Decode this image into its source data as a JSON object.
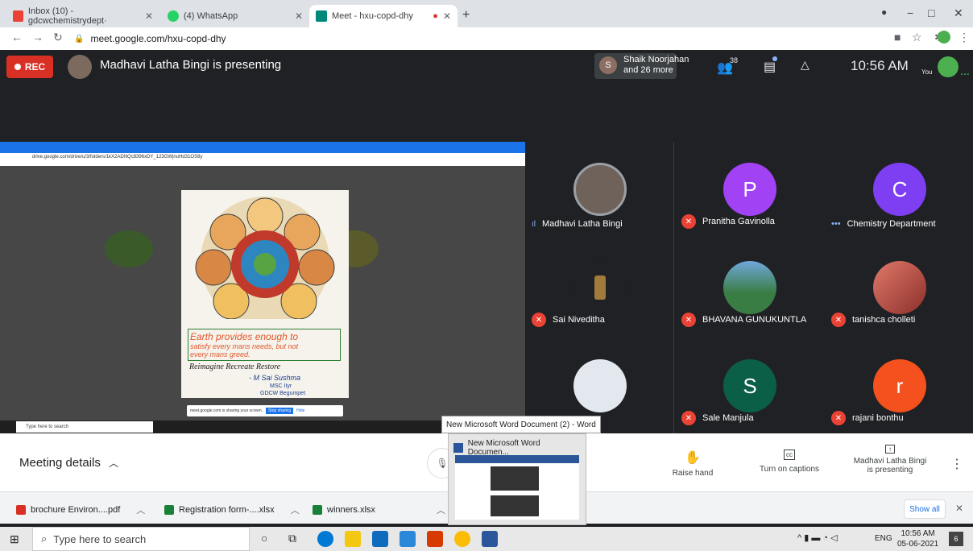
{
  "browser": {
    "tabs": [
      {
        "label": "Inbox (10) - gdcwchemistrydept·",
        "color": "#ea4335"
      },
      {
        "label": "(4) WhatsApp",
        "color": "#25d366"
      },
      {
        "label": "Meet - hxu-copd-dhy",
        "color": "#00897b"
      }
    ],
    "url": "meet.google.com/hxu-copd-dhy"
  },
  "meeting": {
    "rec_label": "REC",
    "presenting_title": "Madhavi Latha Bingi is presenting",
    "notify_name": "Shaik Noorjahan",
    "notify_more": "and 26 more",
    "notify_initial": "S",
    "people_count": "38",
    "time": "10:56 AM",
    "you_label": "You"
  },
  "share": {
    "inner_url": "drive.google.com/drive/u/3/folders/1kX2ADNQc8396xDY_123GWjnuHd31OS8y",
    "poster_line1": "Earth provides enough to",
    "poster_line2": "satisfy every mans needs, but not",
    "poster_line3": "every mans greed.",
    "poster_line4": "Reimagine Recreate Restore",
    "poster_author": "- M Sai Sushma",
    "poster_class": "MSC IIyr",
    "poster_college": "GDCW Begumpet",
    "sharing_text": "meet.google.com is sharing your screen.",
    "stop_sharing": "Stop sharing",
    "hide": "Hide",
    "inner_search": "Type here to search"
  },
  "participants": [
    {
      "name": "Madhavi Latha Bingi",
      "initial": "",
      "color": "#5f6368",
      "muted": false
    },
    {
      "name": "Pranitha Gavinolla",
      "initial": "P",
      "color": "#a142f4",
      "muted": true
    },
    {
      "name": "Chemistry Department",
      "initial": "C",
      "color": "#7e3ff2",
      "muted": false
    },
    {
      "name": "Sai Niveditha",
      "initial": "",
      "color": "#3c2a1a",
      "muted": true
    },
    {
      "name": "BHAVANA GUNUKUNTLA",
      "initial": "",
      "color": "#3a7d44",
      "muted": true
    },
    {
      "name": "tanishca cholleti",
      "initial": "",
      "color": "#b2493f",
      "muted": true
    },
    {
      "name": "",
      "initial": "",
      "color": "#d7dde6",
      "muted": false
    },
    {
      "name": "Sale Manjula",
      "initial": "S",
      "color": "#0b5f47",
      "muted": true
    },
    {
      "name": "rajani bonthu",
      "initial": "r",
      "color": "#f4511e",
      "muted": true
    }
  ],
  "bottom": {
    "meeting_details": "Meeting details",
    "raise_hand": "Raise hand",
    "captions": "Turn on captions",
    "presenter_line1": "Madhavi Latha Bingi",
    "presenter_line2": "is presenting"
  },
  "word_popup": {
    "tooltip": "New Microsoft Word Document (2) - Word",
    "title": "New Microsoft Word Documen..."
  },
  "downloads": [
    {
      "name": "brochure Environ....pdf",
      "color": "#d93025"
    },
    {
      "name": "Registration form-....xlsx",
      "color": "#188038"
    },
    {
      "name": "winners.xlsx",
      "color": "#188038"
    }
  ],
  "show_all": "Show all",
  "taskbar": {
    "search_placeholder": "Type here to search",
    "time": "10:56 AM",
    "date": "05-06-2021",
    "lang": "ENG",
    "notifications": "6"
  }
}
